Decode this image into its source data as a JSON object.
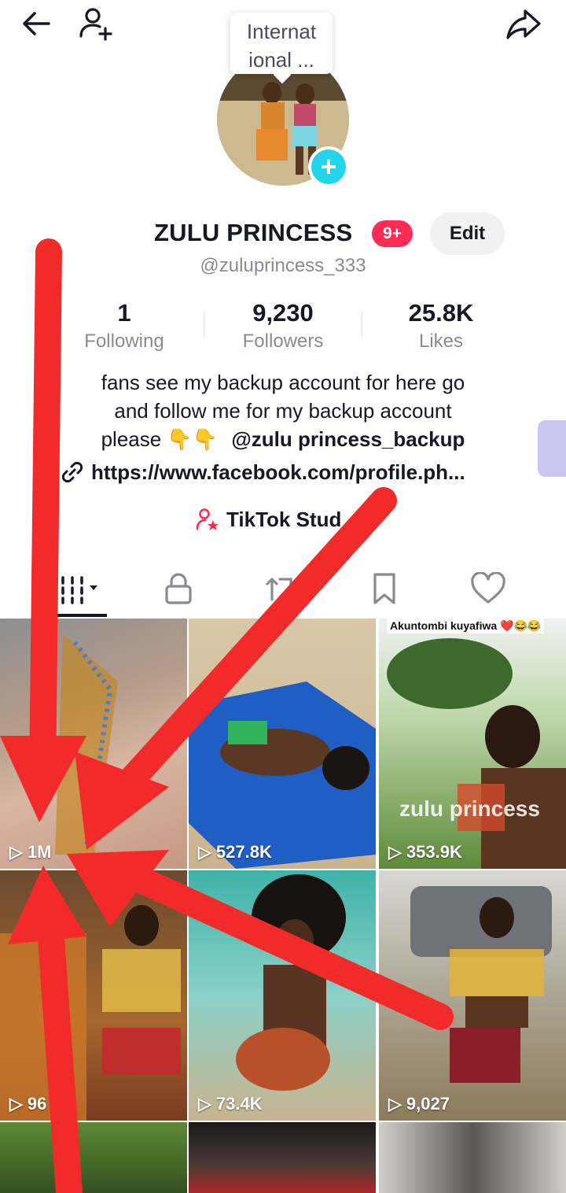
{
  "tooltip": {
    "text": "Internat\nional ..."
  },
  "profile": {
    "name": "ZULU PRINCESS",
    "notification_badge": "9+",
    "edit_label": "Edit",
    "handle": "@zuluprincess_333"
  },
  "stats": [
    {
      "value": "1",
      "label": "Following"
    },
    {
      "value": "9,230",
      "label": "Followers"
    },
    {
      "value": "25.8K",
      "label": "Likes"
    }
  ],
  "bio": {
    "line1": "fans see my backup account for here go",
    "line2": "and follow me for my backup account",
    "line3_prefix": "please 👇👇",
    "mention": "@zulu princess_backup",
    "link": "https://www.facebook.com/profile.ph...",
    "studio_label": "TikTok Stud"
  },
  "tabs": [
    "videos-grid",
    "private",
    "reposts",
    "saved",
    "liked"
  ],
  "videos": [
    {
      "views": "1M",
      "caption": "",
      "overlay": ""
    },
    {
      "views": "527.8K",
      "caption": "",
      "overlay": ""
    },
    {
      "views": "353.9K",
      "caption": "Akuntombi kuyafiwa ❤️😂😂",
      "overlay": "zulu princess"
    },
    {
      "views": "96",
      "caption": "",
      "overlay": ""
    },
    {
      "views": "73.4K",
      "caption": "",
      "overlay": ""
    },
    {
      "views": "9,027",
      "caption": "",
      "overlay": ""
    }
  ],
  "colors": {
    "accent": "#fe2c55",
    "avatar_add": "#20d5ec",
    "annotation_arrow": "#f22a2a"
  }
}
